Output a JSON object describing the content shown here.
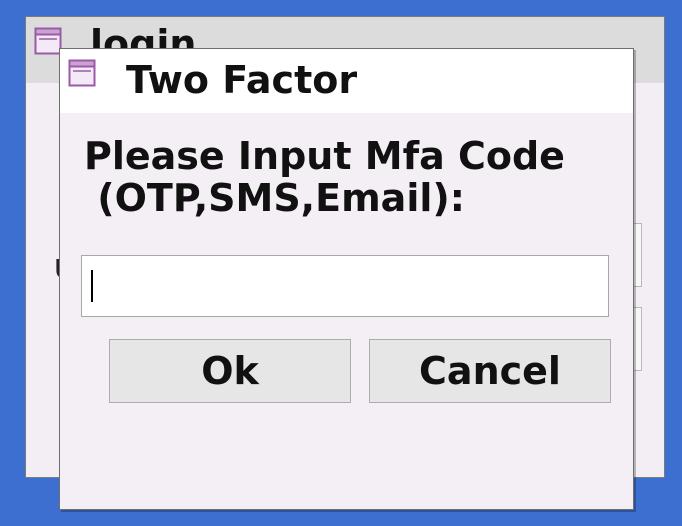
{
  "login_window": {
    "title": "login",
    "icon": "window-icon",
    "partial_label": "U"
  },
  "dialog": {
    "title": "Two Factor",
    "icon": "window-icon",
    "prompt_line1": "Please Input Mfa Code",
    "prompt_line2": " (OTP,SMS,Email):",
    "input_value": "",
    "ok_label": "Ok",
    "cancel_label": "Cancel"
  },
  "colors": {
    "desktop": "#3c6fd0",
    "titlebar_inactive": "#dcdcdc",
    "titlebar_active": "#ffffff",
    "dialog_body": "#f4eff5",
    "icon_accent": "#9b5aa8"
  }
}
